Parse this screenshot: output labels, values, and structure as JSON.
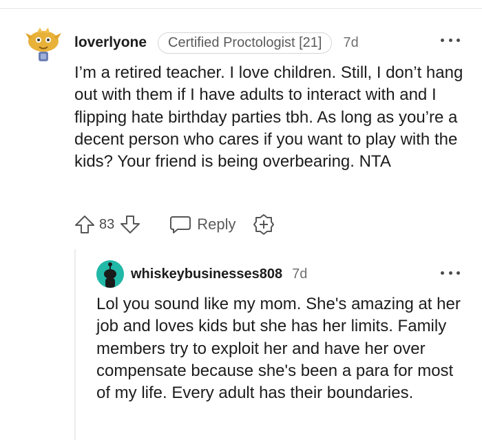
{
  "comment": {
    "username": "loverlyone",
    "flair": "Certified Proctologist [21]",
    "age": "7d",
    "body": "I’m a retired teacher. I love children. Still, I don’t hang out with them if I have adults to interact with and I flipping hate birthday parties tbh. As long as you’re a decent person who cares if you want to play with the kids? Your friend is being overbearing. NTA",
    "score": "83",
    "reply_label": "Reply",
    "icons": {
      "avatar": "cartoon-avatar",
      "more": "more-options-icon",
      "upvote": "upvote-arrow-icon",
      "downvote": "downvote-arrow-icon",
      "reply": "speech-bubble-icon",
      "award": "award-plus-icon"
    }
  },
  "reply": {
    "username": "whiskeybusinesses808",
    "age": "7d",
    "body": "Lol you sound like my mom. She's amazing at her job and loves kids but she has her limits. Family members try to exploit her and have her over compensate because she's been a para for most of my life. Every adult has their boundaries.",
    "avatar_color": "#22b8a8"
  }
}
